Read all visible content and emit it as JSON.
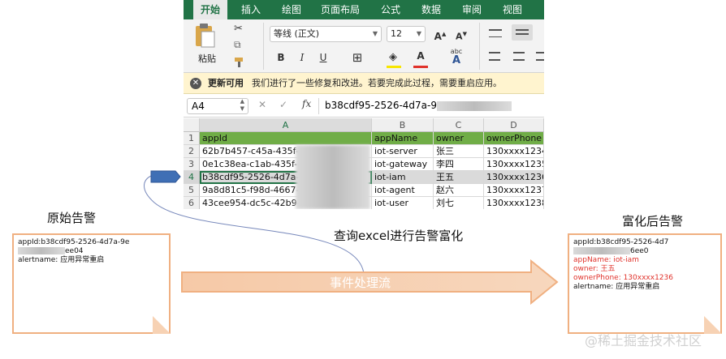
{
  "excel": {
    "tabs": [
      "开始",
      "插入",
      "绘图",
      "页面布局",
      "公式",
      "数据",
      "审阅",
      "视图"
    ],
    "paste_label": "粘贴",
    "font_name": "等线 (正文)",
    "font_size": "12",
    "bold": "B",
    "italic": "I",
    "underline": "U",
    "phonetic_label": "abc",
    "notice": {
      "title": "更新可用",
      "message": "我们进行了一些修复和改进。若要完成此过程，需要重启应用。"
    },
    "name_box": "A4",
    "fx_label": "fx",
    "formula_value": "b38cdf95-2526-4d7a-9",
    "col_headers": [
      "A",
      "B",
      "C",
      "D"
    ],
    "row_numbers": [
      "1",
      "2",
      "3",
      "4",
      "5",
      "6"
    ],
    "table": {
      "headers": [
        "appId",
        "appName",
        "owner",
        "ownerPhone"
      ],
      "rows": [
        [
          "62b7b457-c45a-435f-a",
          "iot-server",
          "张三",
          "130xxxx1234"
        ],
        [
          "0e1c38ea-c1ab-435f-ac",
          "iot-gateway",
          "李四",
          "130xxxx1235"
        ],
        [
          "b38cdf95-2526-4d7a-9",
          "iot-iam",
          "王五",
          "130xxxx1236"
        ],
        [
          "9a8d81c5-f98d-4667-a",
          "iot-agent",
          "赵六",
          "130xxxx1237"
        ],
        [
          "43cee954-dc5c-42b9-9",
          "iot-user",
          "刘七",
          "130xxxx1238"
        ]
      ]
    }
  },
  "left_note": {
    "heading": "原始告警",
    "appid_prefix": "appId:b38cdf95-2526-4d7a-9e",
    "appid_suffix": "ee04",
    "alertname": "alertname: 应用异常重启"
  },
  "middle_label": "查询excel进行告警富化",
  "flow_label": "事件处理流",
  "right_note": {
    "heading": "富化后告警",
    "appid_prefix": "appId:b38cdf95-2526-4d7",
    "appid_suffix": "6ee0",
    "appname": "appName: iot-iam",
    "owner": "owner: 王五",
    "ownerPhone": "ownerPhone: 130xxxx1236",
    "alertname": "alertname: 应用异常重启"
  },
  "watermark": "@稀土掘金技术社区",
  "colors": {
    "excel_green": "#217346",
    "header_row_green": "#70ad47",
    "note_border": "#f0b081",
    "enriched_text_red": "#e0322b",
    "pointer_blue": "#3f6fb5"
  }
}
